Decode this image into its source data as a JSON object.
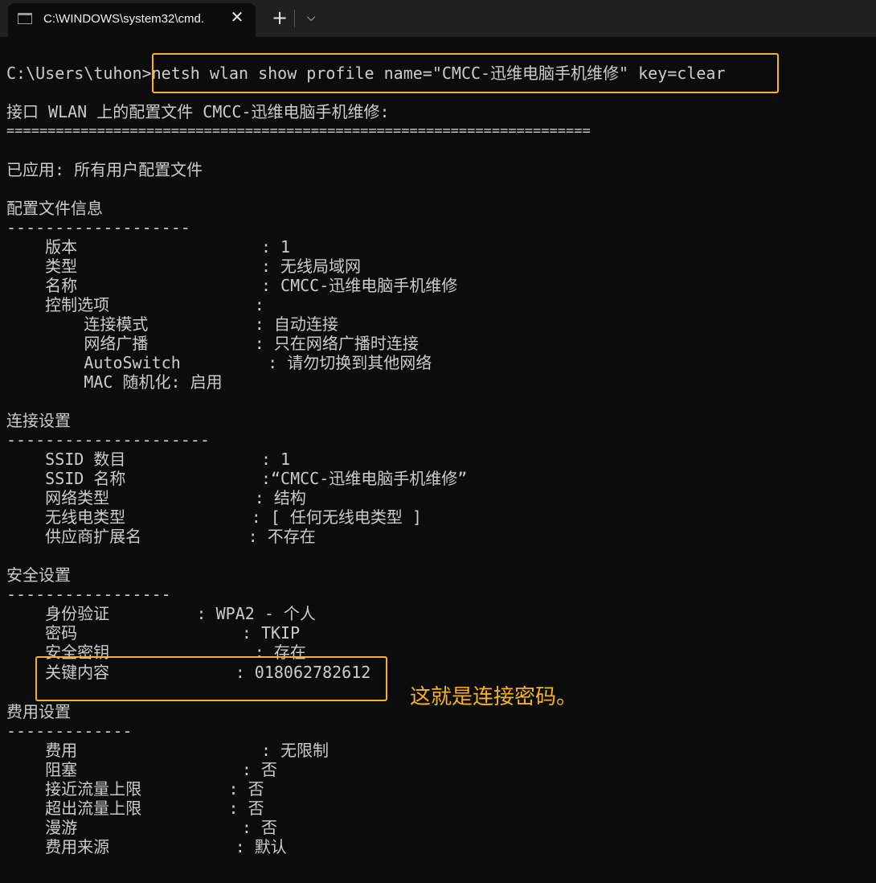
{
  "window": {
    "tab_title": "C:\\WINDOWS\\system32\\cmd.",
    "tab_close": "✕",
    "new_tab": "+",
    "dropdown": "⌵"
  },
  "terminal": {
    "prompt": "C:\\Users\\tuhon>",
    "command": "netsh wlan show profile name=\"CMCC-迅维电脑手机维修\" key=clear",
    "header": "接口 WLAN 上的配置文件 CMCC-迅维电脑手机维修:",
    "header_rule": "=======================================================================",
    "applied": "已应用: 所有用户配置文件",
    "sections": {
      "profile_info": {
        "title": "配置文件信息",
        "rule": "-------------------",
        "lines": [
          "    版本                   : 1",
          "    类型                   : 无线局域网",
          "    名称                   : CMCC-迅维电脑手机维修",
          "    控制选项               :",
          "        连接模式           : 自动连接",
          "        网络广播           : 只在网络广播时连接",
          "        AutoSwitch         : 请勿切换到其他网络",
          "        MAC 随机化: 启用"
        ]
      },
      "connectivity": {
        "title": "连接设置",
        "rule": "---------------------",
        "lines": [
          "    SSID 数目              : 1",
          "    SSID 名称              :“CMCC-迅维电脑手机维修”",
          "    网络类型               : 结构",
          "    无线电类型             : [ 任何无线电类型 ]",
          "    供应商扩展名           : 不存在"
        ]
      },
      "security": {
        "title": "安全设置",
        "rule": "-----------------",
        "lines": [
          "    身份验证         : WPA2 - 个人",
          "    密码                 : TKIP",
          "    安全密钥               : 存在",
          "    关键内容             : 018062782612"
        ]
      },
      "cost": {
        "title": "费用设置",
        "rule": "-------------",
        "lines": [
          "    费用                   : 无限制",
          "    阻塞                 : 否",
          "    接近流量上限         : 否",
          "    超出流量上限         : 否",
          "    漫游                 : 否",
          "    费用来源             : 默认"
        ]
      }
    }
  },
  "annotation": "这就是连接密码。",
  "colors": {
    "background": "#0c0c0c",
    "text": "#cccccc",
    "highlight": "#f6b21f"
  }
}
